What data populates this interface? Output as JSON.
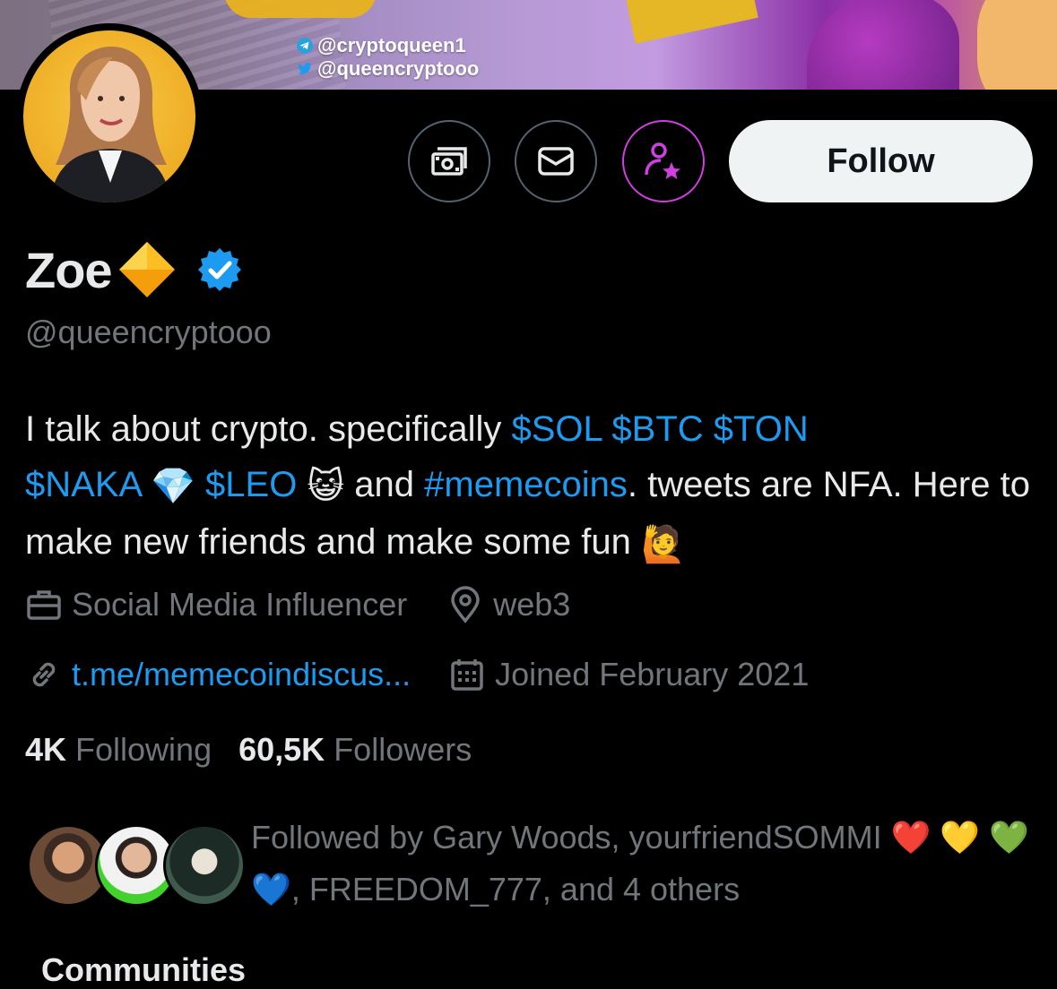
{
  "banner": {
    "telegram_handle": "@cryptoqueen1",
    "twitter_handle": "@queencryptooo",
    "icons": [
      "telegram-icon",
      "twitter-bird-icon"
    ]
  },
  "profile": {
    "name": "Zoe",
    "name_badge_emoji": "🔶",
    "verified": true,
    "handle": "@queencryptooo"
  },
  "actions": {
    "tip_icon": "money-tip-icon",
    "message_icon": "envelope-icon",
    "subscribe_icon": "person-star-icon",
    "follow_label": "Follow"
  },
  "bio": {
    "text1": "I talk about crypto. specifically ",
    "sol": "$SOL",
    "btc": "$BTC",
    "ton": "$TON",
    "naka": "$NAKA",
    "gem": "💎",
    "leo": "$LEO",
    "cat": "😺",
    "and": " and ",
    "hashtag": "#memecoins",
    "text2": ". tweets are NFA. Here to make new friends and make some fun ",
    "raise": "🙋"
  },
  "meta": {
    "profession": "Social Media Influencer",
    "location": "web3",
    "url": "t.me/memecoindiscus...",
    "joined": "Joined February 2021"
  },
  "stats": {
    "following_count": "4K",
    "following_label": "Following",
    "followers_count": "60,5K",
    "followers_label": "Followers"
  },
  "followed_by": {
    "prefix": "Followed by Gary Woods, yourfriendSOMMI ",
    "hearts": "❤️ 💛 💚 💙",
    "suffix": ", FREEDOM_777, and 4 others"
  },
  "section_peek": "Communities",
  "colors": {
    "background": "#000000",
    "text": "#e7e9ea",
    "muted": "#71767b",
    "link": "#1d9bf0",
    "subscribe_accent": "#d13fe0",
    "follow_bg": "#eff3f4"
  }
}
